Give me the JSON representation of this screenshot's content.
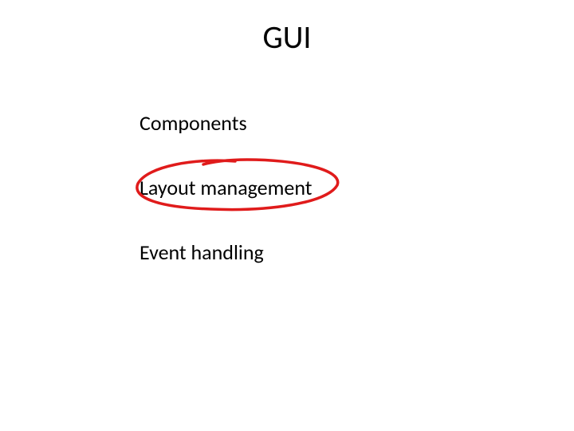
{
  "title": "GUI",
  "items": [
    "Components",
    "Layout management",
    "Event handling"
  ],
  "annotation": {
    "highlighted_index": 1,
    "color": "#e01b1b"
  }
}
